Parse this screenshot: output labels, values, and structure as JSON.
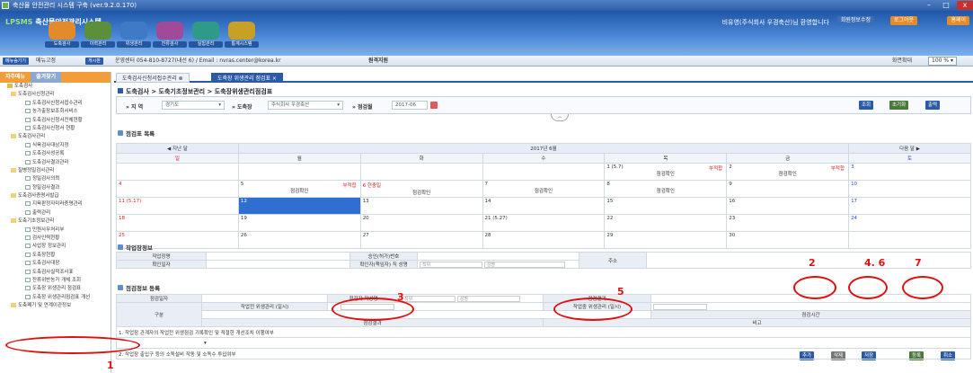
{
  "window": {
    "title": "축산물 안전관리 시스템 구축   (ver.9.2.0.170)",
    "min": "–",
    "max": "□",
    "close": "x"
  },
  "header": {
    "logo_prefix": "LPSMS",
    "logo_text": "축산물안전관리시스템",
    "welcome": "비유영(주식회사 우경축산)님 환영합니다",
    "btn_info": "회원정보수정",
    "btn_logout": "로그아웃",
    "btn_home": "홈페이",
    "nav": [
      {
        "label": "도축검사",
        "color": "#e38a2c"
      },
      {
        "label": "이력관리",
        "color": "#5b8f3a"
      },
      {
        "label": "위생관리",
        "color": "#3f7ac4"
      },
      {
        "label": "잔류검사",
        "color": "#a04b9a"
      },
      {
        "label": "실험관리",
        "color": "#2f9a8a"
      },
      {
        "label": "통계시스템",
        "color": "#c8a028"
      }
    ]
  },
  "toolbar": {
    "menu_toggle": "메뉴숨기기",
    "menu_fix": "메뉴고정",
    "bulletin": "게시판",
    "callcenter": "운영센터 054-810-8727(내선 6) / Email : nvras.center@korea.kr",
    "remote": "원격지원",
    "zoom_label": "화면확대",
    "zoom_value": "100 %"
  },
  "sidebar": {
    "tab_favorites": "자주메뉴",
    "tab_all": "즐겨찾기",
    "items": [
      {
        "label": "도축검사",
        "level": 1
      },
      {
        "label": "도축검사신청관리",
        "level": 2
      },
      {
        "label": "도축검사신청서접수관리",
        "level": 3
      },
      {
        "label": "농가출장보조회서비스",
        "level": 3
      },
      {
        "label": "도축검사신청서전체현황",
        "level": 3
      },
      {
        "label": "도축검사신청서 현황",
        "level": 3
      },
      {
        "label": "도축검사관리",
        "level": 2
      },
      {
        "label": "식육검사대상지정",
        "level": 3
      },
      {
        "label": "도축검사성공록",
        "level": 3
      },
      {
        "label": "도축검사결과관리",
        "level": 3
      },
      {
        "label": "질병정밀검사관리",
        "level": 2
      },
      {
        "label": "정밀검사의뢰",
        "level": 3
      },
      {
        "label": "정밀검사결과",
        "level": 3
      },
      {
        "label": "도축검사증명서발급",
        "level": 2
      },
      {
        "label": "지육판정자미러증명관리",
        "level": 3
      },
      {
        "label": "출력관리",
        "level": 3
      },
      {
        "label": "도축기초정보관리",
        "level": 2
      },
      {
        "label": "민원사무처리부",
        "level": 3
      },
      {
        "label": "검사인력현황",
        "level": 3
      },
      {
        "label": "사업장 정보관리",
        "level": 3
      },
      {
        "label": "도축장현황",
        "level": 3
      },
      {
        "label": "도축검사대장",
        "level": 3
      },
      {
        "label": "도축검사실적조사표",
        "level": 3
      },
      {
        "label": "잔류위반농가 개체 조회",
        "level": 3
      },
      {
        "label": "도축장 위생관리 점검표",
        "level": 3
      },
      {
        "label": "도축장 위생관리점검표 개선",
        "level": 3
      },
      {
        "label": "도축폐기 및 연계이관정보",
        "level": 2
      }
    ]
  },
  "tabs": [
    "도축검사신청서접수관리",
    "도축장 위생관리 점검표"
  ],
  "breadcrumb": "도축검사 > 도축기초정보관리 > 도축장위생관리점검표",
  "search": {
    "region_label": "지 역",
    "region_value": "경기도",
    "plant_label": "도축장",
    "plant_value": "주식회사 우경축산",
    "month_label": "점검월",
    "month_value": "2017-06",
    "btn_search": "조회",
    "btn_reset": "초기화",
    "btn_print": "출력"
  },
  "calendar": {
    "section_title": "점검표 목록",
    "prev": "◀ 지난 달",
    "month": "2017년 6월",
    "next": "다음 달 ▶",
    "days": [
      "일",
      "월",
      "화",
      "수",
      "목",
      "금",
      "토"
    ],
    "weeks": [
      [
        {
          "d": ""
        },
        {
          "d": ""
        },
        {
          "d": ""
        },
        {
          "d": ""
        },
        {
          "d": "1 (5.7)",
          "tag": "부적합",
          "st": "점검확인"
        },
        {
          "d": "2",
          "tag": "부적합",
          "st": "점검확인"
        },
        {
          "d": "3"
        }
      ],
      [
        {
          "d": "4"
        },
        {
          "d": "5",
          "tag": "부적합",
          "st": "점검확인"
        },
        {
          "d": "6 현충일",
          "st": "점검확인"
        },
        {
          "d": "7",
          "st": "점검확인"
        },
        {
          "d": "8",
          "st": "점검확인"
        },
        {
          "d": "9"
        },
        {
          "d": "10"
        }
      ],
      [
        {
          "d": "11 (5.17)"
        },
        {
          "d": "12",
          "sel": true
        },
        {
          "d": "13"
        },
        {
          "d": "14"
        },
        {
          "d": "15"
        },
        {
          "d": "16"
        },
        {
          "d": "17"
        }
      ],
      [
        {
          "d": "18"
        },
        {
          "d": "19"
        },
        {
          "d": "20"
        },
        {
          "d": "21 (5.27)"
        },
        {
          "d": "22"
        },
        {
          "d": "23"
        },
        {
          "d": "24"
        }
      ],
      [
        {
          "d": "25"
        },
        {
          "d": "26"
        },
        {
          "d": "27"
        },
        {
          "d": "28"
        },
        {
          "d": "29"
        },
        {
          "d": "30"
        },
        {
          "d": ""
        }
      ]
    ]
  },
  "work": {
    "section_title": "작업장정보",
    "name_label": "작업장명",
    "confirm_date_label": "확인일자",
    "permit_label": "승인(허가)번호",
    "confirmer_label": "확인자(책임자) 직 성명",
    "rank_ph": "직위",
    "name_ph": "성명",
    "addr_label": "주소"
  },
  "inspect": {
    "section_title": "점검정보 등록",
    "date_label": "점검일자",
    "writer_label": "점검자 작성명",
    "rank_ph": "직위",
    "name_ph": "성명",
    "result_label": "점검결과",
    "category_label": "구분",
    "pre_label": "작업전 위생관리 (일시)",
    "during_label": "작업중 위생관리 (일시)",
    "time_label": "점검시간",
    "result_col": "점검결과",
    "remarks_col": "비고",
    "q1": "1. 작업장 관계자의 작업전 위생점검 기록확인 및 적절한 개선조치 이행여부",
    "q2": "2. 작업장 출입구 등의 소독설비 작동 및 소독수 투입여부",
    "btn_add": "추가",
    "btn_delete": "삭제",
    "btn_save": "저장",
    "btn_register": "등록",
    "btn_cancel": "취소"
  },
  "annotations": [
    "1",
    "2",
    "3",
    "4. 6",
    "5",
    "7"
  ]
}
